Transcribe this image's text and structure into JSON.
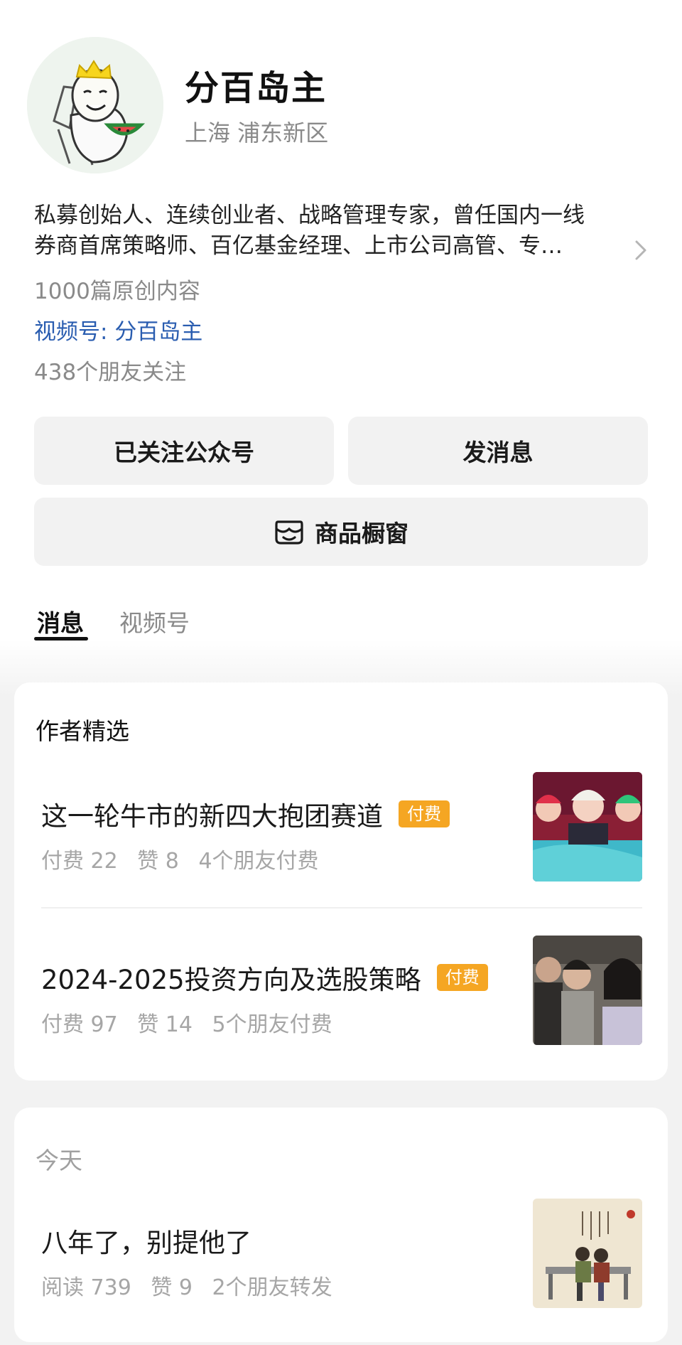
{
  "profile": {
    "name": "分百岛主",
    "location": "上海 浦东新区",
    "bio_line1": "私募创始人、连续创业者、战略管理专家，曾任国内一线",
    "bio_line2": "券商首席策略师、百亿基金经理、上市公司高管、专…",
    "original_count": "1000篇原创内容",
    "channel_label": "视频号: ",
    "channel_name": "分百岛主",
    "followers": "438个朋友关注"
  },
  "actions": {
    "follow_label": "已关注公众号",
    "message_label": "发消息",
    "shop_label": "商品橱窗"
  },
  "tabs": [
    {
      "label": "消息",
      "active": true
    },
    {
      "label": "视频号",
      "active": false
    }
  ],
  "featured": {
    "title": "作者精选",
    "articles": [
      {
        "title": "这一轮牛市的新四大抱团赛道",
        "badge": "付费",
        "paid": "付费 22",
        "likes": "赞 8",
        "friends": "4个朋友付费"
      },
      {
        "title": "2024-2025投资方向及选股策略",
        "badge": "付费",
        "paid": "付费 97",
        "likes": "赞 14",
        "friends": "5个朋友付费"
      }
    ]
  },
  "today": {
    "title": "今天",
    "articles": [
      {
        "title": "八年了，别提他了",
        "reads": "阅读 739",
        "likes": "赞 9",
        "friends": "2个朋友转发"
      }
    ]
  },
  "colors": {
    "accent_link": "#2a5db0",
    "paid_badge": "#f5a623",
    "secondary_text": "#8a8a8a"
  },
  "icons": {
    "bio_more": "chevron-right-icon",
    "shop": "shop-window-icon"
  }
}
